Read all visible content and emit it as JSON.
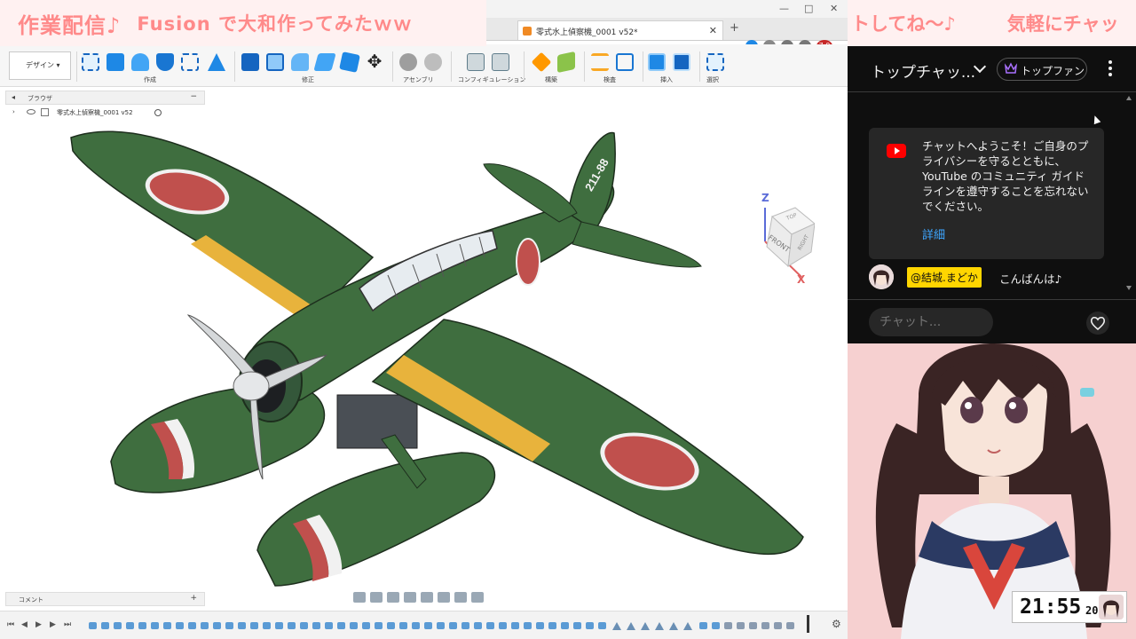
{
  "banner": {
    "title": "作業配信♪",
    "subtitle": "Fusion で大和作ってみたｗｗ",
    "ticker": [
      "トしてね～♪",
      "気軽にチャッ"
    ]
  },
  "window": {
    "tab_title": "零式水上偵察機_0001 v52*",
    "version_badge": "7.0"
  },
  "toolbar": {
    "workspace": "デザイン",
    "groups": [
      "作成",
      "修正",
      "アセンブリ",
      "コンフィギュレーション",
      "構築",
      "検査",
      "挿入",
      "選択"
    ]
  },
  "browser": {
    "header": "ブラウザ",
    "root_item": "零式水上偵察機_0001 v52"
  },
  "viewcube": {
    "top": "TOP",
    "front": "FRONT",
    "right": "RIGHT",
    "axis_z": "Z",
    "axis_x": "X"
  },
  "model": {
    "tail_code": "211-88"
  },
  "comments": {
    "label": "コメント"
  },
  "chat": {
    "title": "トップチャッ...",
    "filter_label": "トップファン",
    "welcome_text": "チャットへようこそ！ご自身のプライバシーを守るとともに、YouTube のコミュニティ ガイドラインを遵守することを忘れないでください。",
    "welcome_link": "詳細",
    "messages": [
      {
        "author": "@結城.まどか",
        "text": "こんばんは♪"
      }
    ],
    "input_placeholder": "チャット..."
  },
  "clock": {
    "time": "21:55",
    "seconds": "20"
  },
  "colors": {
    "banner_text": "#ff8a8a",
    "banner_bg": "#fff1f1",
    "chat_bg": "#0f0f0f",
    "link": "#3ea6ff",
    "author_badge": "#ffd600",
    "plane_green": "#3f6e3f",
    "hinomaru": "#c0504d",
    "wing_band": "#e8b33c",
    "avatar_bg": "#f6d0d0"
  },
  "icons": [
    "gear-icon",
    "heart-icon",
    "crown-icon",
    "youtube-icon",
    "eye-icon",
    "play-icon",
    "kebab-menu-icon"
  ]
}
